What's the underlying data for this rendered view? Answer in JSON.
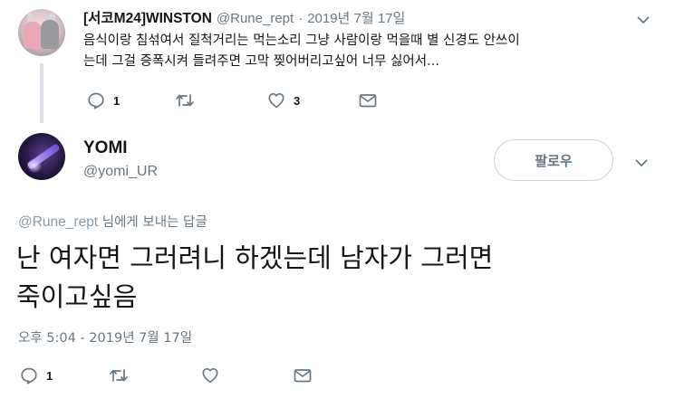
{
  "parent_tweet": {
    "name": "[서코M24]WINSTON",
    "handle": "@Rune_rept",
    "separator": "·",
    "date": "2019년 7월 17일",
    "text": "음식이랑 침섞여서 질척거리는 먹는소리 그냥 사람이랑 먹을때 별 신경도 안쓰이\n는데 그걸 증폭시켜 들려주면 고막 찢어버리고싶어 너무 싫어서...",
    "actions": {
      "reply_count": "1",
      "like_count": "3"
    }
  },
  "main_tweet": {
    "name": "YOMI",
    "handle": "@yomi_UR",
    "follow_label": "팔로우",
    "reply_to_handle": "@Rune_rept",
    "reply_to_suffix": " 님에게 보내는 답글",
    "text": "난 여자면 그러려니 하겠는데 남자가 그러면\n죽이고싶음",
    "timestamp": "오후 5:04 - 2019년 7월 17일",
    "actions": {
      "reply_count": "1"
    }
  },
  "icons": {
    "reply": "reply-icon",
    "retweet": "retweet-icon",
    "like": "heart-icon",
    "dm": "envelope-icon",
    "caret": "chevron-down-icon"
  },
  "colors": {
    "text": "#14171a",
    "secondary": "#657786",
    "icon": "#657786",
    "border": "#ccd6dd",
    "thread_line": "#dbe1e6"
  }
}
